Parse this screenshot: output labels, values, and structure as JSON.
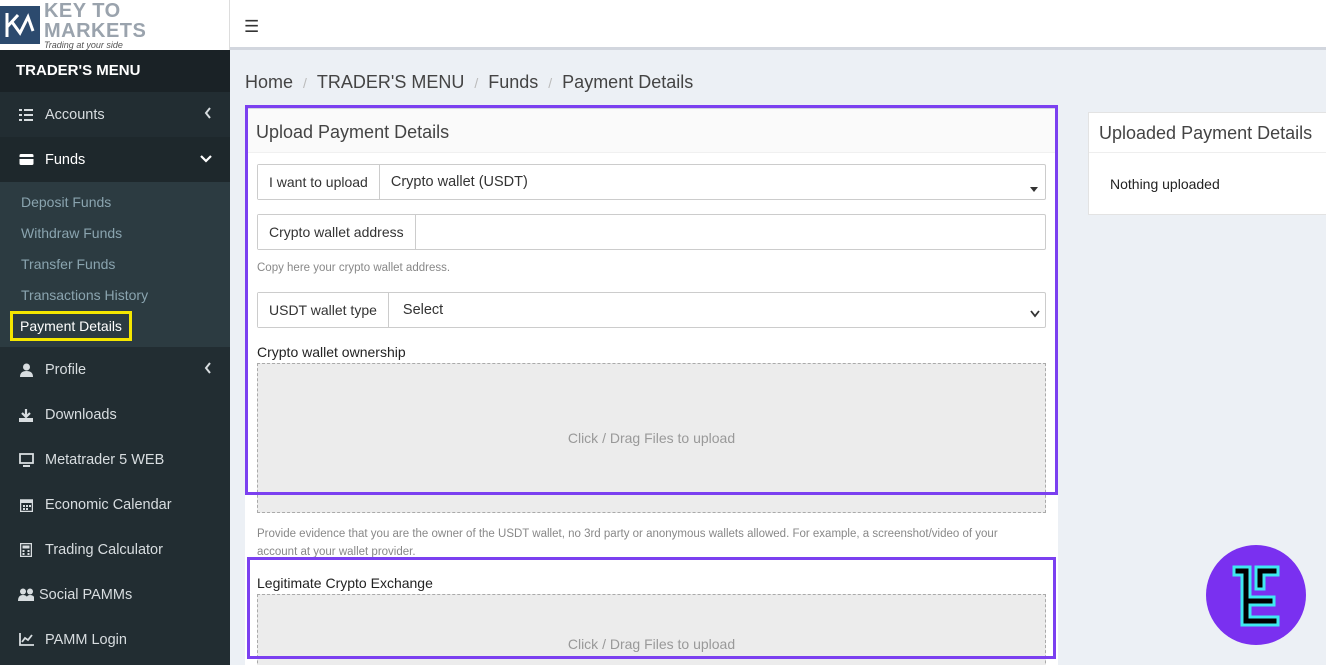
{
  "logo": {
    "name": "KEY TO MARKETS",
    "tagline": "Trading at your side"
  },
  "sidebar": {
    "header": "TRADER'S MENU",
    "items": [
      {
        "label": "Accounts",
        "icon": "list-icon"
      },
      {
        "label": "Funds",
        "icon": "wallet-icon"
      },
      {
        "label": "Profile",
        "icon": "user-icon"
      },
      {
        "label": "Downloads",
        "icon": "download-icon"
      },
      {
        "label": "Metatrader 5 WEB",
        "icon": "monitor-icon"
      },
      {
        "label": "Economic Calendar",
        "icon": "calendar-icon"
      },
      {
        "label": "Trading Calculator",
        "icon": "calculator-icon"
      },
      {
        "label": "Social PAMMs",
        "icon": "users-icon"
      },
      {
        "label": "PAMM Login",
        "icon": "chart-icon"
      }
    ],
    "funds_submenu": [
      "Deposit Funds",
      "Withdraw Funds",
      "Transfer Funds",
      "Transactions History",
      "Payment Details"
    ]
  },
  "breadcrumb": [
    "Home",
    "TRADER'S MENU",
    "Funds",
    "Payment Details"
  ],
  "upload": {
    "title": "Upload Payment Details",
    "type_label": "I want to upload",
    "type_value": "Crypto wallet (USDT)",
    "address_label": "Crypto wallet address",
    "address_value": "",
    "address_help": "Copy here your crypto wallet address.",
    "wallet_type_label": "USDT wallet type",
    "wallet_type_value": "Select",
    "ownership_label": "Crypto wallet ownership",
    "dropzone_text": "Click / Drag Files to upload",
    "ownership_help_1": "Provide evidence that you are the owner of the USDT wallet, no 3rd party or anonymous wallets allowed. For example, a screenshot/video of your",
    "ownership_help_2": "account at your wallet provider.",
    "exchange_label": "Legitimate Crypto Exchange",
    "dropzone_text_2": "Click / Drag Files to upload"
  },
  "uploaded": {
    "title": "Uploaded Payment Details",
    "empty_text": "Nothing uploaded"
  },
  "colors": {
    "sidebar_bg": "#222d32",
    "highlight_purple": "#7b40f0",
    "highlight_yellow": "#f4e600",
    "badge_bg": "#7a30f0"
  }
}
